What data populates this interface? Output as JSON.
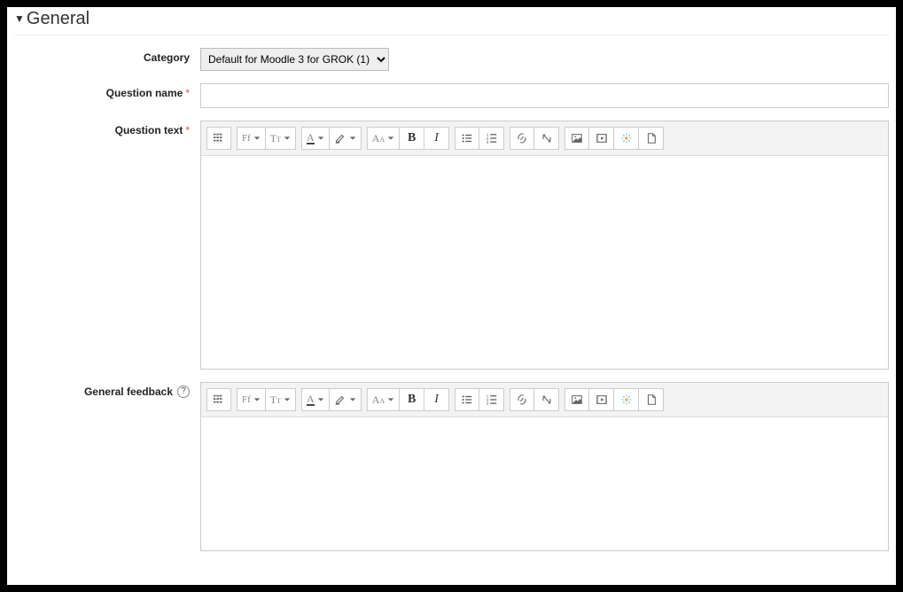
{
  "section": {
    "title": "General"
  },
  "fields": {
    "category": {
      "label": "Category",
      "selected": "Default for Moodle 3 for GROK (1)"
    },
    "question_name": {
      "label": "Question name",
      "value": ""
    },
    "question_text": {
      "label": "Question text"
    },
    "general_feedback": {
      "label": "General feedback"
    }
  },
  "toolbar": {
    "toggle": "Toggle toolbar",
    "font_family": "Font family",
    "font_size": "Font size",
    "font_color": "Font color",
    "highlight": "Highlight color",
    "paragraph": "Paragraph format",
    "bold": "Bold",
    "italic": "Italic",
    "ul": "Bulleted list",
    "ol": "Numbered list",
    "link": "Insert link",
    "unlink": "Remove link",
    "image": "Insert image",
    "media": "Insert media",
    "equation": "Equation editor",
    "html": "HTML source"
  }
}
